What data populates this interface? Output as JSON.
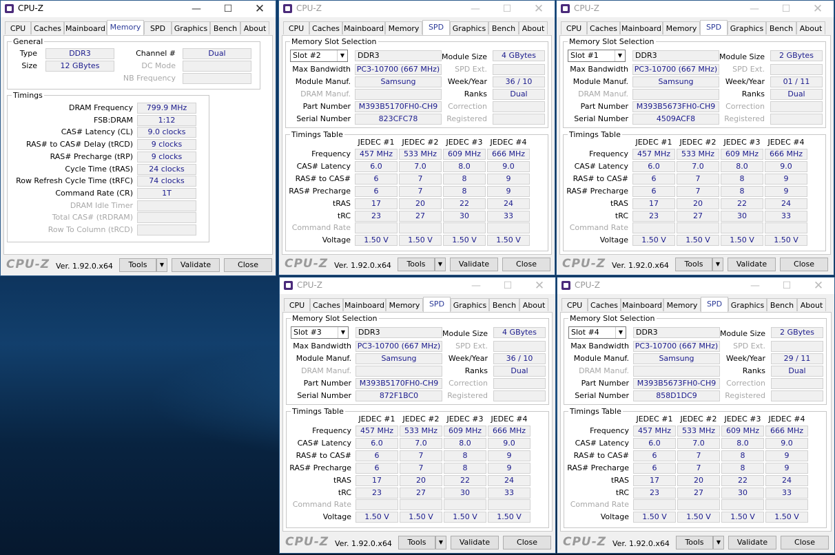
{
  "app": {
    "title": "CPU-Z",
    "version": "Ver. 1.92.0.x64",
    "logo": "CPU-Z",
    "tabs": [
      "CPU",
      "Caches",
      "Mainboard",
      "Memory",
      "SPD",
      "Graphics",
      "Bench",
      "About"
    ],
    "tools_label": "Tools",
    "validate_label": "Validate",
    "close_label": "Close"
  },
  "memory": {
    "general_title": "General",
    "type_label": "Type",
    "type_value": "DDR3",
    "size_label": "Size",
    "size_value": "12 GBytes",
    "channel_label": "Channel #",
    "channel_value": "Dual",
    "dc_mode_label": "DC Mode",
    "nb_freq_label": "NB Frequency",
    "timings_title": "Timings",
    "rows": [
      {
        "label": "DRAM Frequency",
        "value": "799.9 MHz",
        "dim": false
      },
      {
        "label": "FSB:DRAM",
        "value": "1:12",
        "dim": false
      },
      {
        "label": "CAS# Latency (CL)",
        "value": "9.0 clocks",
        "dim": false
      },
      {
        "label": "RAS# to CAS# Delay (tRCD)",
        "value": "9 clocks",
        "dim": false
      },
      {
        "label": "RAS# Precharge (tRP)",
        "value": "9 clocks",
        "dim": false
      },
      {
        "label": "Cycle Time (tRAS)",
        "value": "24 clocks",
        "dim": false
      },
      {
        "label": "Row Refresh Cycle Time (tRFC)",
        "value": "74 clocks",
        "dim": false
      },
      {
        "label": "Command Rate (CR)",
        "value": "1T",
        "dim": false
      },
      {
        "label": "DRAM Idle Timer",
        "value": "",
        "dim": true
      },
      {
        "label": "Total CAS# (tRDRAM)",
        "value": "",
        "dim": true
      },
      {
        "label": "Row To Column (tRCD)",
        "value": "",
        "dim": true
      }
    ]
  },
  "spd_labels": {
    "slot_group": "Memory Slot Selection",
    "module_size": "Module Size",
    "max_bandwidth": "Max Bandwidth",
    "spd_ext": "SPD Ext.",
    "module_manuf": "Module Manuf.",
    "week_year": "Week/Year",
    "dram_manuf": "DRAM Manuf.",
    "ranks": "Ranks",
    "part_number": "Part Number",
    "correction": "Correction",
    "serial_number": "Serial Number",
    "registered": "Registered",
    "timings_table": "Timings Table",
    "jedec_headers": [
      "JEDEC #1",
      "JEDEC #2",
      "JEDEC #3",
      "JEDEC #4"
    ],
    "row_labels": [
      "Frequency",
      "CAS# Latency",
      "RAS# to CAS#",
      "RAS# Precharge",
      "tRAS",
      "tRC",
      "Command Rate",
      "Voltage"
    ]
  },
  "timings": [
    [
      "457 MHz",
      "533 MHz",
      "609 MHz",
      "666 MHz"
    ],
    [
      "6.0",
      "7.0",
      "8.0",
      "9.0"
    ],
    [
      "6",
      "7",
      "8",
      "9"
    ],
    [
      "6",
      "7",
      "8",
      "9"
    ],
    [
      "17",
      "20",
      "22",
      "24"
    ],
    [
      "23",
      "27",
      "30",
      "33"
    ],
    [
      "",
      "",
      "",
      ""
    ],
    [
      "1.50 V",
      "1.50 V",
      "1.50 V",
      "1.50 V"
    ]
  ],
  "spd": [
    {
      "slot": "Slot #2",
      "type": "DDR3",
      "module_size": "4 GBytes",
      "max_bandwidth": "PC3-10700 (667 MHz)",
      "module_manuf": "Samsung",
      "week_year": "36 / 10",
      "ranks": "Dual",
      "part_number": "M393B5170FH0-CH9",
      "serial_number": "823CFC78"
    },
    {
      "slot": "Slot #1",
      "type": "DDR3",
      "module_size": "2 GBytes",
      "max_bandwidth": "PC3-10700 (667 MHz)",
      "module_manuf": "Samsung",
      "week_year": "01 / 11",
      "ranks": "Dual",
      "part_number": "M393B5673FH0-CH9",
      "serial_number": "4509ACF8"
    },
    {
      "slot": "Slot #3",
      "type": "DDR3",
      "module_size": "4 GBytes",
      "max_bandwidth": "PC3-10700 (667 MHz)",
      "module_manuf": "Samsung",
      "week_year": "36 / 10",
      "ranks": "Dual",
      "part_number": "M393B5170FH0-CH9",
      "serial_number": "872F1BC0"
    },
    {
      "slot": "Slot #4",
      "type": "DDR3",
      "module_size": "2 GBytes",
      "max_bandwidth": "PC3-10700 (667 MHz)",
      "module_manuf": "Samsung",
      "week_year": "29 / 11",
      "ranks": "Dual",
      "part_number": "M393B5673FH0-CH9",
      "serial_number": "858D1DC9"
    }
  ]
}
